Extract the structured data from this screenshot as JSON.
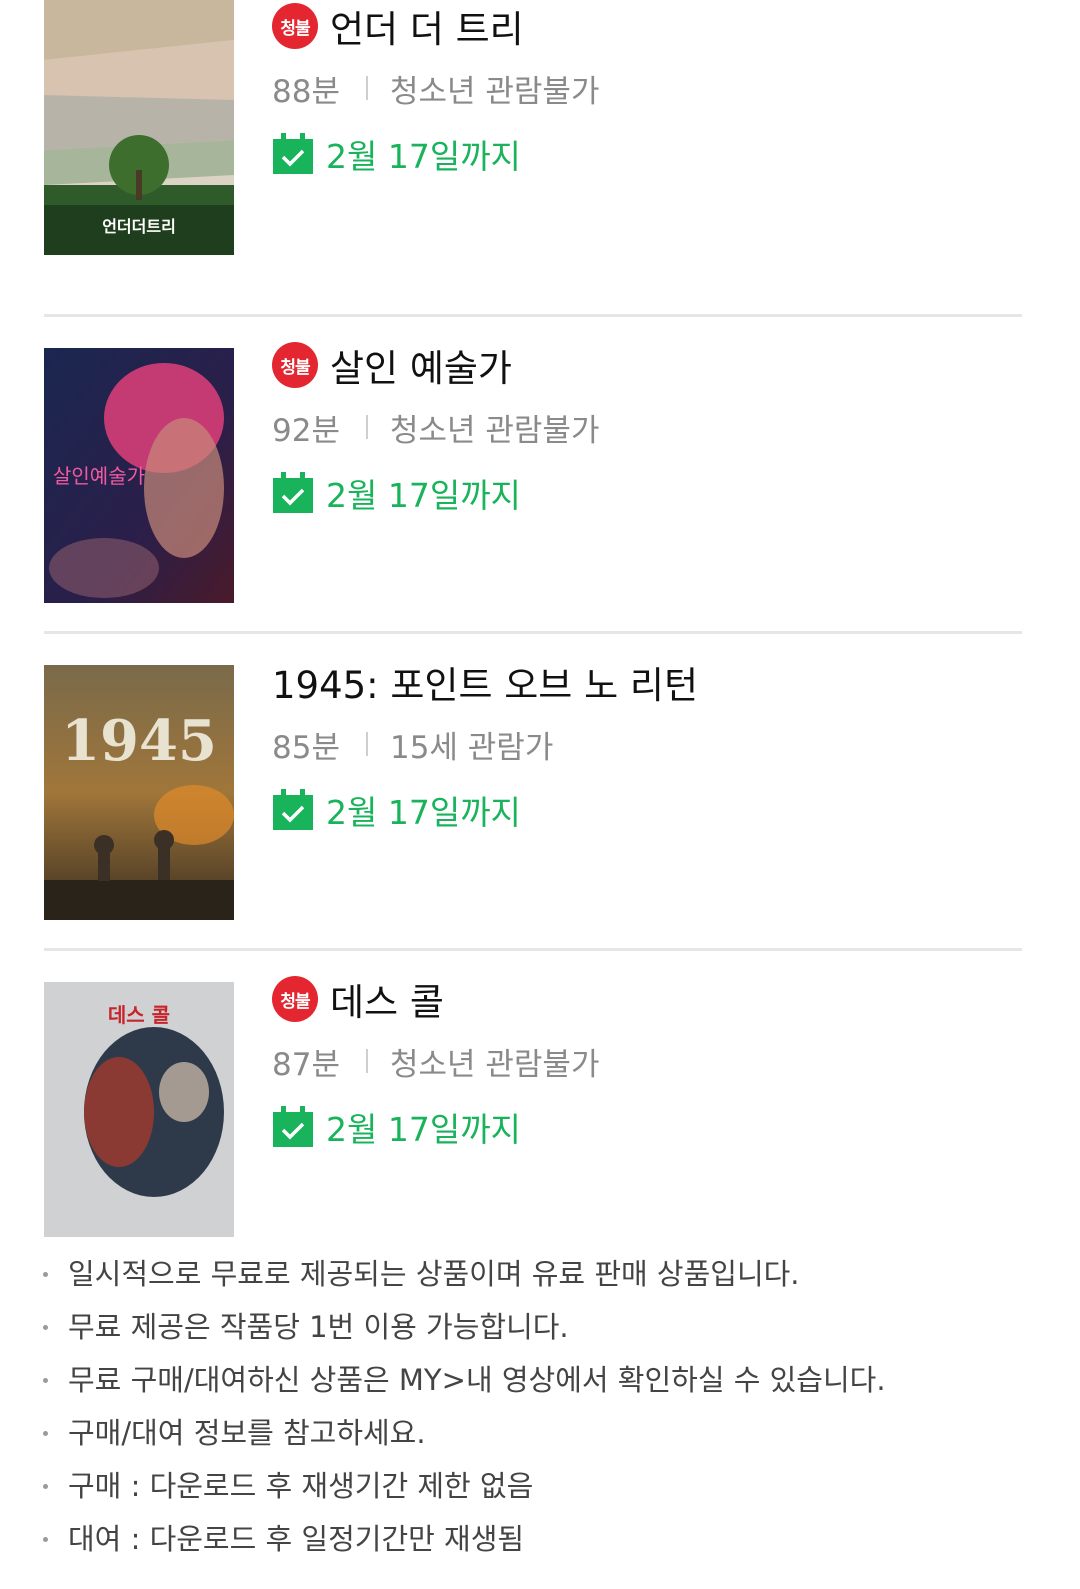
{
  "colors": {
    "badge": "#e3262f",
    "available": "#18b35a",
    "meta": "#8a8a8a"
  },
  "items": [
    {
      "title": "언더 더 트리",
      "badge": "청불",
      "runtime": "88분",
      "rating": "청소년 관람불가",
      "until": "2월 17일까지",
      "poster_text": "언더더트리"
    },
    {
      "title": "살인 예술가",
      "badge": "청불",
      "runtime": "92분",
      "rating": "청소년 관람불가",
      "until": "2월 17일까지",
      "poster_text": "살인예술가"
    },
    {
      "title": "1945: 포인트 오브 노 리턴",
      "badge": "",
      "runtime": "85분",
      "rating": "15세 관람가",
      "until": "2월 17일까지",
      "poster_text": "1945"
    },
    {
      "title": "데스 콜",
      "badge": "청불",
      "runtime": "87분",
      "rating": "청소년 관람불가",
      "until": "2월 17일까지",
      "poster_text": "데스 콜"
    }
  ],
  "notes": [
    "일시적으로 무료로 제공되는 상품이며 유료 판매 상품입니다.",
    "무료 제공은 작품당 1번 이용 가능합니다.",
    "무료 구매/대여하신 상품은 MY>내 영상에서 확인하실 수 있습니다.",
    "구매/대여 정보를 참고하세요.",
    "구매 : 다운로드 후 재생기간 제한 없음",
    "대여 : 다운로드 후 일정기간만 재생됨"
  ]
}
